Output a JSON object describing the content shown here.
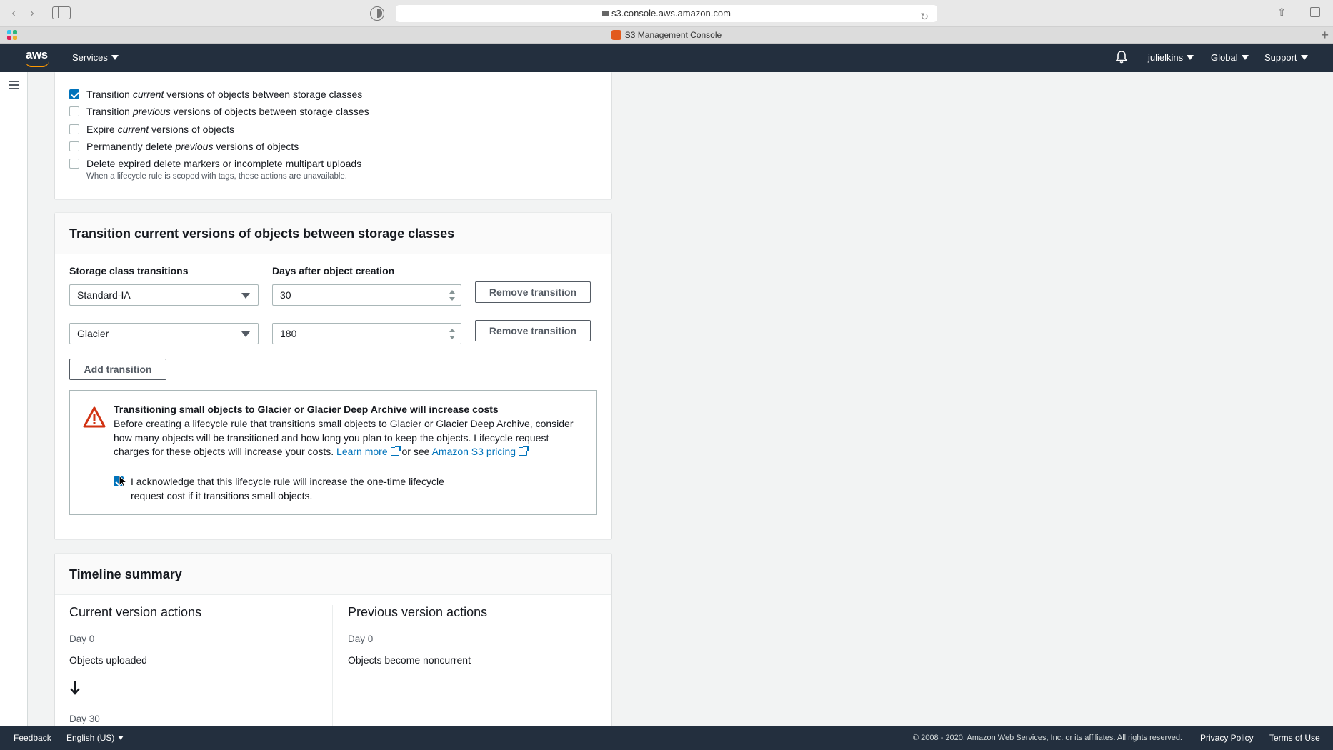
{
  "browser": {
    "url": "s3.console.aws.amazon.com",
    "tab_title": "S3 Management Console"
  },
  "header": {
    "logo_text": "aws",
    "services_label": "Services",
    "user_label": "julielkins",
    "region_label": "Global",
    "support_label": "Support"
  },
  "actions_panel": {
    "options": [
      {
        "pre": "Transition ",
        "em": "current",
        "post": " versions of objects between storage classes",
        "checked": true
      },
      {
        "pre": "Transition ",
        "em": "previous",
        "post": " versions of objects between storage classes",
        "checked": false
      },
      {
        "pre": "Expire ",
        "em": "current",
        "post": " versions of objects",
        "checked": false
      },
      {
        "pre": "Permanently delete ",
        "em": "previous",
        "post": " versions of objects",
        "checked": false
      },
      {
        "pre": "Delete expired delete markers or incomplete multipart uploads",
        "em": "",
        "post": "",
        "checked": false
      }
    ],
    "hint": "When a lifecycle rule is scoped with tags, these actions are unavailable."
  },
  "transition_panel": {
    "title": "Transition current versions of objects between storage classes",
    "storage_class_label": "Storage class transitions",
    "days_label": "Days after object creation",
    "transitions": [
      {
        "storage_class": "Standard-IA",
        "days": "30",
        "remove_label": "Remove transition"
      },
      {
        "storage_class": "Glacier",
        "days": "180",
        "remove_label": "Remove transition"
      }
    ],
    "add_label": "Add transition",
    "warning": {
      "title": "Transitioning small objects to Glacier or Glacier Deep Archive will increase costs",
      "body": "Before creating a lifecycle rule that transitions small objects to Glacier or Glacier Deep Archive, consider how many objects will be transitioned and how long you plan to keep the objects. Lifecycle request charges for these objects will increase your costs.",
      "learn_more": "Learn more",
      "or_see": "or see",
      "pricing_link": "Amazon S3 pricing",
      "ack_text": "I acknowledge that this lifecycle rule will increase the one-time lifecycle request cost if it transitions small objects.",
      "ack_checked": true
    }
  },
  "timeline_panel": {
    "title": "Timeline summary",
    "current_title": "Current version actions",
    "previous_title": "Previous version actions",
    "current_day0": "Day 0",
    "current_event0": "Objects uploaded",
    "current_day1": "Day 30",
    "previous_day0": "Day 0",
    "previous_event0": "Objects become noncurrent"
  },
  "footer": {
    "feedback": "Feedback",
    "language": "English (US)",
    "copyright": "© 2008 - 2020, Amazon Web Services, Inc. or its affiliates. All rights reserved.",
    "privacy": "Privacy Policy",
    "terms": "Terms of Use"
  },
  "colors": {
    "header_bg": "#232f3e",
    "accent_orange": "#ff9900",
    "link_blue": "#0073bb",
    "warning_red": "#d13212"
  }
}
